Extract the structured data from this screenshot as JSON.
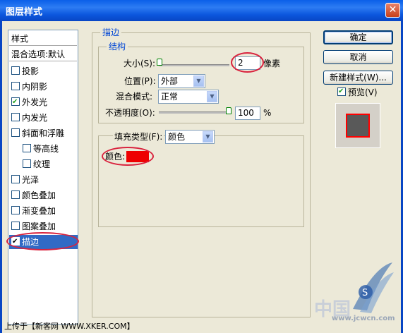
{
  "window": {
    "title": "图层样式",
    "close_glyph": "✕"
  },
  "sidebar": {
    "header": "样式",
    "blend_options": "混合选项:默认",
    "items": [
      {
        "label": "投影",
        "checked": false
      },
      {
        "label": "内阴影",
        "checked": false
      },
      {
        "label": "外发光",
        "checked": true
      },
      {
        "label": "内发光",
        "checked": false
      },
      {
        "label": "斜面和浮雕",
        "checked": false
      },
      {
        "label": "等高线",
        "checked": false
      },
      {
        "label": "纹理",
        "checked": false
      },
      {
        "label": "光泽",
        "checked": false
      },
      {
        "label": "颜色叠加",
        "checked": false
      },
      {
        "label": "渐变叠加",
        "checked": false
      },
      {
        "label": "图案叠加",
        "checked": false
      },
      {
        "label": "描边",
        "checked": true,
        "selected": true
      }
    ]
  },
  "stroke": {
    "group_title": "描边",
    "structure_title": "结构",
    "size_label": "大小(S):",
    "size_value": "2",
    "size_unit": "像素",
    "position_label": "位置(P):",
    "position_value": "外部",
    "blend_label": "混合模式:",
    "blend_value": "正常",
    "opacity_label": "不透明度(O):",
    "opacity_value": "100",
    "opacity_unit": "%",
    "fill_type_label": "填充类型(F):",
    "fill_type_value": "颜色",
    "color_label": "颜色:",
    "color_hex": "#ee0000"
  },
  "buttons": {
    "ok": "确定",
    "cancel": "取消",
    "new_style": "新建样式(W)...",
    "preview_label": "预览(V)",
    "preview_checked": true
  },
  "footer": {
    "text": "上传于【新客网 WWW.XKER.COM】"
  },
  "watermark": {
    "text": "中国",
    "site": "www.jcwcn.com"
  }
}
